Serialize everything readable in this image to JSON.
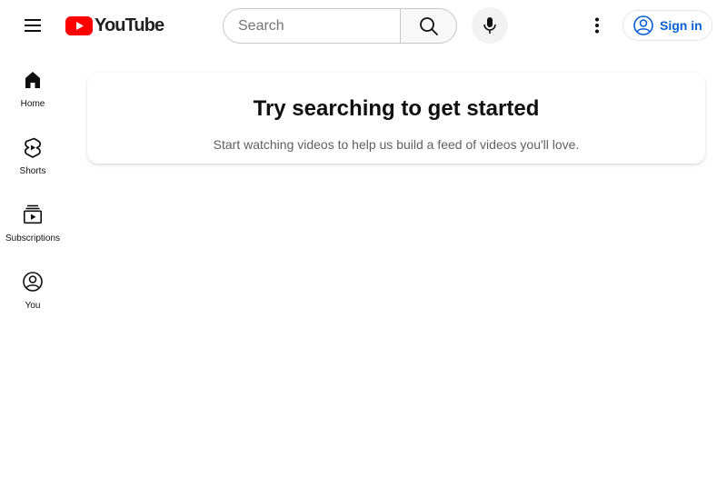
{
  "header": {
    "menu_icon": "hamburger-menu-icon",
    "logo": {
      "icon": "youtube-play-icon",
      "text": "YouTube",
      "brand_color": "#ff0000"
    },
    "search": {
      "placeholder": "Search",
      "value": "",
      "icon": "search-icon"
    },
    "mic_icon": "microphone-icon",
    "more_icon": "vertical-dots-icon",
    "sign_in": {
      "label": "Sign in",
      "icon": "account-circle-icon",
      "color": "#065fd4"
    }
  },
  "guide": {
    "items": [
      {
        "label": "Home",
        "icon": "home-icon"
      },
      {
        "label": "Shorts",
        "icon": "shorts-icon"
      },
      {
        "label": "Subscriptions",
        "icon": "subscriptions-icon"
      },
      {
        "label": "You",
        "icon": "you-icon"
      }
    ]
  },
  "main": {
    "title": "Try searching to get started",
    "subtitle": "Start watching videos to help us build a feed of videos you'll love."
  }
}
